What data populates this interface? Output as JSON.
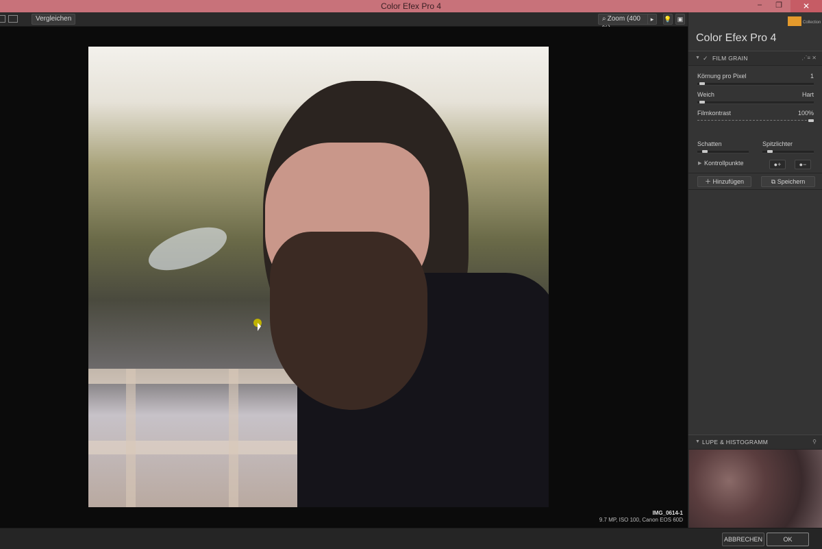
{
  "window": {
    "title": "Color Efex Pro 4",
    "minimize": "–",
    "restore": "❐",
    "close": "✕"
  },
  "toolbar": {
    "compare_label": "Vergleichen",
    "zoom_label": "Zoom (400 %)",
    "zoom_arrow": "▸"
  },
  "image_info": {
    "filename": "IMG_0614-1",
    "details": "9.7 MP, ISO 100, Canon EOS 60D"
  },
  "panel": {
    "brand_small": "Collection",
    "app_name": "Color Efex Pro",
    "app_version": "4",
    "filter": {
      "name": "FILM GRAIN",
      "enabled": true,
      "controls": [
        {
          "label": "Körnung pro Pixel",
          "value": "1",
          "level": 0.02
        },
        {
          "label": "Weich",
          "value": "Hart",
          "level": 0.02
        },
        {
          "label": "Filmkontrast",
          "value": "100%",
          "level": 1.0
        }
      ],
      "shadows_label": "Schatten",
      "highlights_label": "Spitzlichter",
      "control_points_label": "Kontrollpunkte",
      "add_label": "Hinzufügen",
      "save_label": "Speichern"
    },
    "loupe_header": "LUPE & HISTOGRAMM"
  },
  "bottom": {
    "cancel_label": "ABBRECHEN",
    "ok_label": "OK"
  },
  "colors": {
    "titlebar": "#c8727a",
    "panel_bg": "#343434",
    "accent_brand": "#e49a2c"
  }
}
